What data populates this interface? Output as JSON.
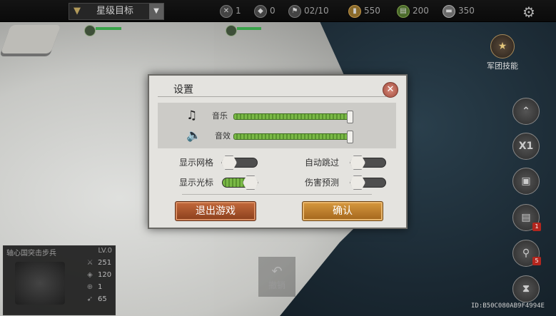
{
  "topbar": {
    "dropdown_label": "星级目标",
    "resources": [
      {
        "icon": "cross-icon",
        "value": "1"
      },
      {
        "icon": "shield-icon",
        "value": "0"
      },
      {
        "icon": "flag-icon",
        "value": "02/10"
      },
      {
        "icon": "ammo-icon",
        "value": "550"
      },
      {
        "icon": "supply-icon",
        "value": "200"
      },
      {
        "icon": "steel-icon",
        "value": "350"
      }
    ]
  },
  "legion_skill_label": "军团技能",
  "side_buttons": {
    "speed_label": "X1",
    "bag_badge": "1",
    "search_badge": "5"
  },
  "unit_panel": {
    "name": "轴心国突击步兵",
    "level": "LV.0",
    "stats": [
      "251",
      "120",
      "1",
      "65"
    ]
  },
  "undo_label": "撤销",
  "id_text": "ID:B50C080AB9F4994E",
  "settings": {
    "title": "设置",
    "music_label": "音乐",
    "sfx_label": "音效",
    "music_level": 1.0,
    "sfx_level": 1.0,
    "toggles": {
      "show_grid": {
        "label": "显示网格",
        "on": false
      },
      "auto_skip": {
        "label": "自动跳过",
        "on": false
      },
      "show_cursor": {
        "label": "显示光标",
        "on": true
      },
      "damage_preview": {
        "label": "伤害预测",
        "on": false
      }
    },
    "exit_label": "退出游戏",
    "confirm_label": "确认"
  }
}
